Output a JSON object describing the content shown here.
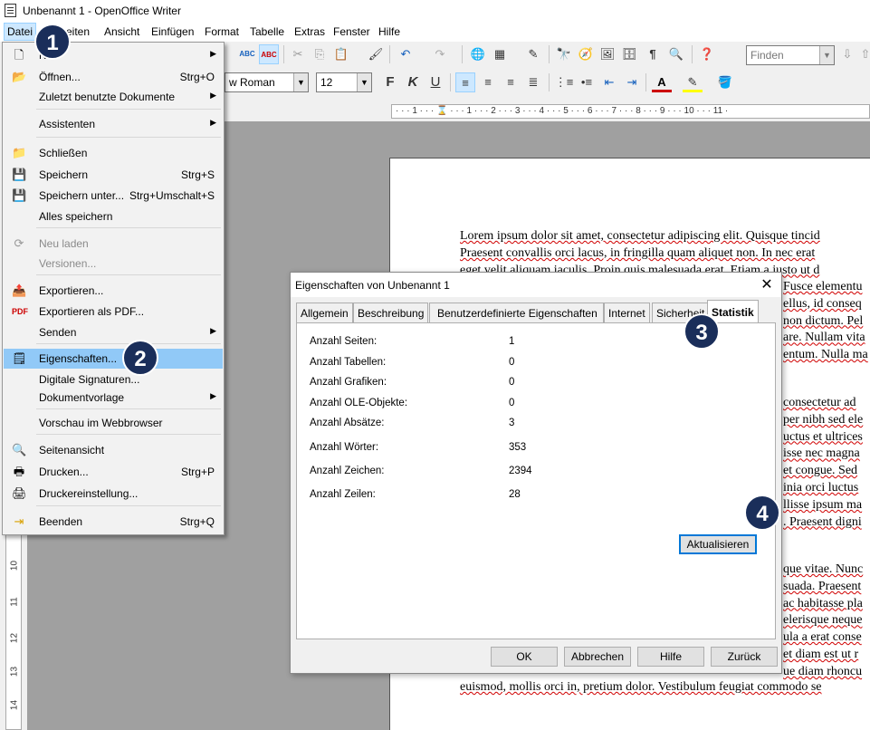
{
  "window": {
    "title": "Unbenannt 1 - OpenOffice Writer"
  },
  "menubar": [
    "Datei",
    "Bearbeiten",
    "Ansicht",
    "Einfügen",
    "Format",
    "Tabelle",
    "Extras",
    "Fenster",
    "Hilfe"
  ],
  "menubar_visible": {
    "datei": "Datei",
    "bearbeiten": "eiten",
    "ansicht": "Ansicht",
    "einfuegen": "Einfügen",
    "format": "Format",
    "tabelle": "Tabelle",
    "extras": "Extras",
    "fenster": "Fenster",
    "hilfe": "Hilfe"
  },
  "toolbar": {
    "find_placeholder": "Finden",
    "font_name": "w Roman",
    "font_size": "12",
    "spell_label": "ABC"
  },
  "ruler": {
    "marks": "· · · 1 · · · ⌛ · · · 1 · · · 2 · · · 3 · · · 4 · · · 5 · · · 6 · · · 7 · · · 8 · · · 9 · · · 10 · · · 11 ·"
  },
  "vruler": [
    "10",
    "11",
    "12",
    "13",
    "14"
  ],
  "datei_menu": {
    "items": {
      "neu": {
        "label": "Neu",
        "icon": "new-document-icon"
      },
      "oeffnen": {
        "label": "Öffnen...",
        "shortcut": "Strg+O"
      },
      "zuletzt": {
        "label": "Zuletzt benutzte Dokumente"
      },
      "assistenten": {
        "label": "Assistenten"
      },
      "schliessen": {
        "label": "Schließen"
      },
      "speichern": {
        "label": "Speichern",
        "shortcut": "Strg+S"
      },
      "speichern_unter": {
        "label": "Speichern unter...",
        "shortcut": "Strg+Umschalt+S"
      },
      "alles_speichern": {
        "label": "Alles speichern"
      },
      "neu_laden": {
        "label": "Neu laden"
      },
      "versionen": {
        "label": "Versionen..."
      },
      "exportieren": {
        "label": "Exportieren..."
      },
      "exportieren_pdf": {
        "label": "Exportieren als PDF..."
      },
      "senden": {
        "label": "Senden"
      },
      "eigenschaften": {
        "label": "Eigenschaften..."
      },
      "digitale_signaturen": {
        "label": "Digitale Signaturen..."
      },
      "dokumentvorlage": {
        "label": "Dokumentvorlage"
      },
      "vorschau": {
        "label": "Vorschau im Webbrowser"
      },
      "seitenansicht": {
        "label": "Seitenansicht"
      },
      "drucken": {
        "label": "Drucken...",
        "shortcut": "Strg+P"
      },
      "druckereinstellung": {
        "label": "Druckereinstellung..."
      },
      "beenden": {
        "label": "Beenden",
        "shortcut": "Strg+Q"
      }
    }
  },
  "document": {
    "para1": [
      "Lorem ipsum dolor sit amet, consectetur adipiscing elit. Quisque tincid",
      "Praesent convallis orci lacus, in fringilla quam aliquet non. In nec erat",
      "eget velit aliquam iaculis. Proin quis malesuada erat. Etiam a justo ut d"
    ],
    "right_fragments": [
      "Fusce elementu",
      "ellus, id conseq",
      "non dictum. Pel",
      "are. Nullam vita",
      "entum. Nulla ma"
    ],
    "para2_fragments": [
      "consectetur ad",
      "per nibh sed ele",
      "uctus et ultrices",
      "isse nec magna",
      "et congue. Sed",
      "inia orci luctus",
      "llisse ipsum ma",
      ". Praesent digni"
    ],
    "para3_fragments": [
      "que vitae. Nunc",
      "suada. Praesent",
      "ac habitasse pla",
      "elerisque neque",
      "ula a erat conse",
      "et diam est ut r",
      "ue diam rhoncu"
    ],
    "last_line": "euismod, mollis orci in, pretium dolor. Vestibulum feugiat commodo se"
  },
  "dialog": {
    "title": "Eigenschaften von Unbenannt 1",
    "tabs": [
      "Allgemein",
      "Beschreibung",
      "Benutzerdefinierte Eigenschaften",
      "Internet",
      "Sicherheit",
      "Statistik"
    ],
    "stats": [
      {
        "label": "Anzahl Seiten:",
        "value": "1"
      },
      {
        "label": "Anzahl Tabellen:",
        "value": "0"
      },
      {
        "label": "Anzahl Grafiken:",
        "value": "0"
      },
      {
        "label": "Anzahl OLE-Objekte:",
        "value": "0"
      },
      {
        "label": "Anzahl Absätze:",
        "value": "3"
      },
      {
        "label": "Anzahl Wörter:",
        "value": "353"
      },
      {
        "label": "Anzahl Zeichen:",
        "value": "2394"
      },
      {
        "label": "Anzahl Zeilen:",
        "value": "28"
      }
    ],
    "refresh_label": "Aktualisieren",
    "buttons": {
      "ok": "OK",
      "cancel": "Abbrechen",
      "help": "Hilfe",
      "back": "Zurück"
    }
  },
  "markers": [
    "1",
    "2",
    "3",
    "4"
  ],
  "colors": {
    "marker_bg": "#1a2e5a",
    "menu_highlight": "#91c9f7",
    "spell_underline": "#d00000"
  }
}
